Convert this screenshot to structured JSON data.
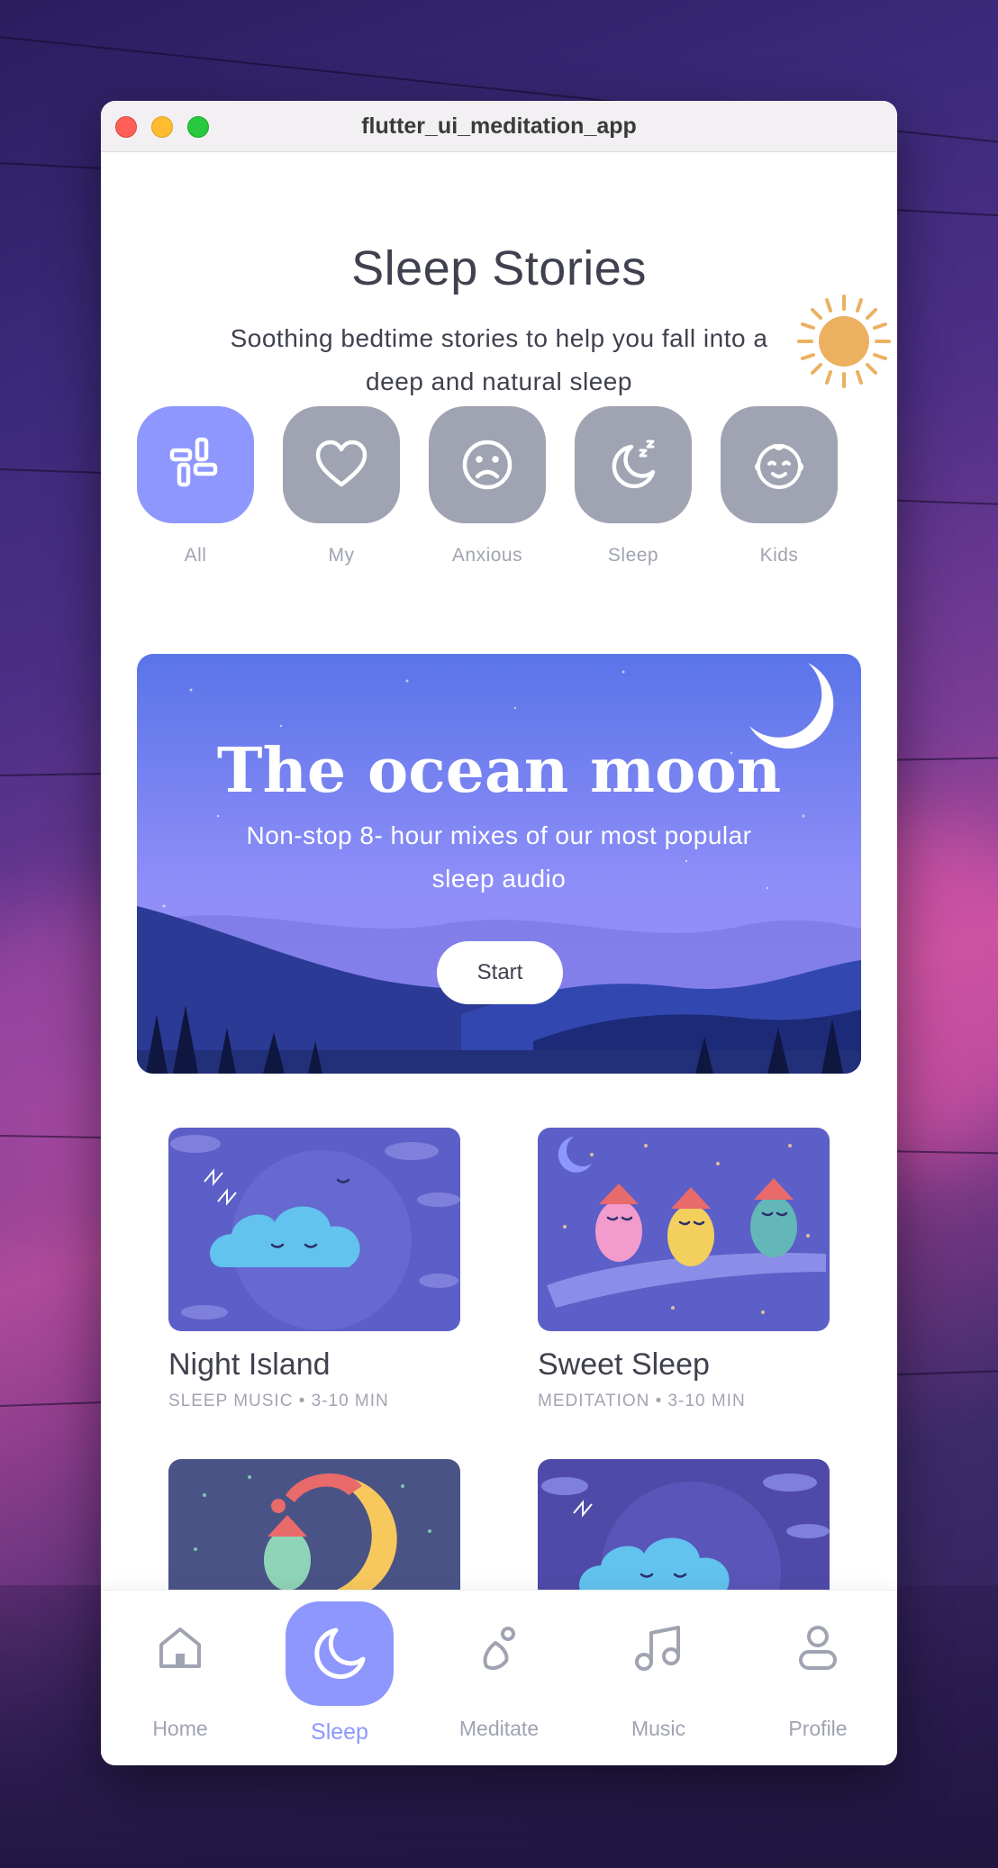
{
  "window": {
    "title": "flutter_ui_meditation_app"
  },
  "header": {
    "title": "Sleep Stories",
    "subtitle": "Soothing bedtime stories to help you fall into a deep and natural sleep"
  },
  "categories": [
    {
      "label": "All",
      "icon": "grid-icon",
      "active": true
    },
    {
      "label": "My",
      "icon": "heart-icon",
      "active": false
    },
    {
      "label": "Anxious",
      "icon": "sad-face-icon",
      "active": false
    },
    {
      "label": "Sleep",
      "icon": "moon-zzz-icon",
      "active": false
    },
    {
      "label": "Kids",
      "icon": "baby-face-icon",
      "active": false
    }
  ],
  "banner": {
    "title": "The ocean moon",
    "subtitle": "Non-stop 8- hour mixes of our most popular sleep audio",
    "button_label": "Start"
  },
  "stories": [
    {
      "title": "Night Island",
      "meta": "SLEEP MUSIC • 3-10 MIN"
    },
    {
      "title": "Sweet Sleep",
      "meta": "MEDITATION • 3-10 MIN"
    },
    {
      "title": "",
      "meta": ""
    },
    {
      "title": "",
      "meta": ""
    }
  ],
  "bottom_nav": [
    {
      "label": "Home",
      "icon": "home-icon",
      "active": false
    },
    {
      "label": "Sleep",
      "icon": "moon-icon",
      "active": true
    },
    {
      "label": "Meditate",
      "icon": "meditate-icon",
      "active": false
    },
    {
      "label": "Music",
      "icon": "music-note-icon",
      "active": false
    },
    {
      "label": "Profile",
      "icon": "profile-icon",
      "active": false
    }
  ],
  "colors": {
    "accent": "#8e97fd",
    "inactive_tile": "#a0a3b1",
    "text_primary": "#3f414e",
    "sun": "#f0b05a"
  }
}
